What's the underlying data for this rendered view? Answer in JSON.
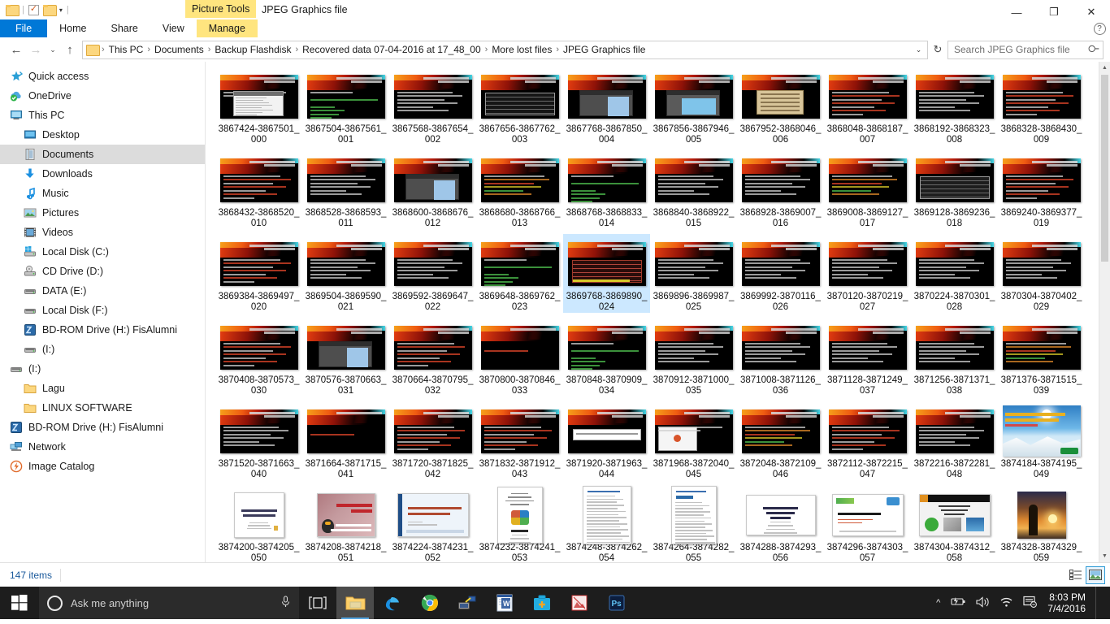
{
  "window": {
    "context_tab_group": "Picture Tools",
    "title": "JPEG Graphics file",
    "minimize": "—",
    "maximize": "❐",
    "close": "✕"
  },
  "ribbon": {
    "tabs": [
      {
        "label": "File",
        "type": "file"
      },
      {
        "label": "Home",
        "type": "normal"
      },
      {
        "label": "Share",
        "type": "normal"
      },
      {
        "label": "View",
        "type": "normal"
      },
      {
        "label": "Manage",
        "type": "contextual"
      }
    ],
    "help": "?"
  },
  "addressbar": {
    "back": "←",
    "forward": "→",
    "recent": "⌄",
    "up": "↑",
    "breadcrumbs": [
      "This PC",
      "Documents",
      "Backup Flashdisk",
      "Recovered data 07-04-2016 at 17_48_00",
      "More lost files",
      "JPEG Graphics file"
    ],
    "separator": "›",
    "dropdown": "⌄",
    "refresh": "↻",
    "search_placeholder": "Search JPEG Graphics file",
    "search_value": ""
  },
  "sidebar": {
    "items": [
      {
        "label": "Quick access",
        "icon": "star-icon",
        "indent": 0,
        "selected": false
      },
      {
        "label": "OneDrive",
        "icon": "cloud-icon",
        "indent": 0,
        "selected": false
      },
      {
        "label": "This PC",
        "icon": "monitor-icon",
        "indent": 0,
        "selected": false
      },
      {
        "label": "Desktop",
        "icon": "desktop-icon",
        "indent": 1,
        "selected": false
      },
      {
        "label": "Documents",
        "icon": "documents-icon",
        "indent": 1,
        "selected": true
      },
      {
        "label": "Downloads",
        "icon": "download-icon",
        "indent": 1,
        "selected": false
      },
      {
        "label": "Music",
        "icon": "music-icon",
        "indent": 1,
        "selected": false
      },
      {
        "label": "Pictures",
        "icon": "pictures-icon",
        "indent": 1,
        "selected": false
      },
      {
        "label": "Videos",
        "icon": "videos-icon",
        "indent": 1,
        "selected": false
      },
      {
        "label": "Local Disk (C:)",
        "icon": "windows-drive-icon",
        "indent": 1,
        "selected": false
      },
      {
        "label": "CD Drive (D:)",
        "icon": "cd-drive-icon",
        "indent": 1,
        "selected": false
      },
      {
        "label": "DATA (E:)",
        "icon": "drive-icon",
        "indent": 1,
        "selected": false
      },
      {
        "label": "Local Disk (F:)",
        "icon": "drive-icon",
        "indent": 1,
        "selected": false
      },
      {
        "label": "BD-ROM Drive (H:) FisAlumni",
        "icon": "bdrom-icon",
        "indent": 1,
        "selected": false
      },
      {
        "label": "(I:)",
        "icon": "drive-icon",
        "indent": 1,
        "selected": false
      },
      {
        "label": "(I:)",
        "icon": "drive-icon",
        "indent": 0,
        "selected": false
      },
      {
        "label": "Lagu",
        "icon": "folder-icon",
        "indent": 1,
        "selected": false
      },
      {
        "label": "LINUX SOFTWARE",
        "icon": "folder-icon",
        "indent": 1,
        "selected": false
      },
      {
        "label": "BD-ROM Drive (H:) FisAlumni",
        "icon": "bdrom-icon",
        "indent": 0,
        "selected": false
      },
      {
        "label": "Network",
        "icon": "network-icon",
        "indent": 0,
        "selected": false
      },
      {
        "label": "Image Catalog",
        "icon": "image-catalog-icon",
        "indent": 0,
        "selected": false
      }
    ]
  },
  "files": [
    {
      "name": "3867424-3867501_000",
      "thumb": "slide-screenshot-light",
      "selected": false
    },
    {
      "name": "3867504-3867561_001",
      "thumb": "slide-code",
      "selected": false
    },
    {
      "name": "3867568-3867654_002",
      "thumb": "slide-text",
      "selected": false
    },
    {
      "name": "3867656-3867762_003",
      "thumb": "slide-table-win",
      "selected": false
    },
    {
      "name": "3867768-3867850_004",
      "thumb": "slide-darkwin",
      "selected": false
    },
    {
      "name": "3867856-3867946_005",
      "thumb": "slide-bluewin",
      "selected": false
    },
    {
      "name": "3867952-3868046_006",
      "thumb": "slide-tanbox",
      "selected": false
    },
    {
      "name": "3868048-3868187_007",
      "thumb": "slide-text-red",
      "selected": false
    },
    {
      "name": "3868192-3868323_008",
      "thumb": "slide-text",
      "selected": false
    },
    {
      "name": "3868328-3868430_009",
      "thumb": "slide-text-red",
      "selected": false
    },
    {
      "name": "3868432-3868520_010",
      "thumb": "slide-text-red",
      "selected": false
    },
    {
      "name": "3868528-3868593_011",
      "thumb": "slide-text",
      "selected": false
    },
    {
      "name": "3868600-3868676_012",
      "thumb": "slide-darkwin",
      "selected": false
    },
    {
      "name": "3868680-3868766_013",
      "thumb": "slide-colorcode",
      "selected": false
    },
    {
      "name": "3868768-3868833_014",
      "thumb": "slide-code",
      "selected": false
    },
    {
      "name": "3868840-3868922_015",
      "thumb": "slide-text",
      "selected": false
    },
    {
      "name": "3868928-3869007_016",
      "thumb": "slide-text",
      "selected": false
    },
    {
      "name": "3869008-3869127_017",
      "thumb": "slide-colorcode",
      "selected": false
    },
    {
      "name": "3869128-3869236_018",
      "thumb": "slide-table",
      "selected": false
    },
    {
      "name": "3869240-3869377_019",
      "thumb": "slide-text-red",
      "selected": false
    },
    {
      "name": "3869384-3869497_020",
      "thumb": "slide-text-red",
      "selected": false
    },
    {
      "name": "3869504-3869590_021",
      "thumb": "slide-text",
      "selected": false
    },
    {
      "name": "3869592-3869647_022",
      "thumb": "slide-text",
      "selected": false
    },
    {
      "name": "3869648-3869762_023",
      "thumb": "slide-code",
      "selected": false
    },
    {
      "name": "3869768-3869890_024",
      "thumb": "slide-table-red",
      "selected": true
    },
    {
      "name": "3869896-3869987_025",
      "thumb": "slide-text",
      "selected": false
    },
    {
      "name": "3869992-3870116_026",
      "thumb": "slide-text",
      "selected": false
    },
    {
      "name": "3870120-3870219_027",
      "thumb": "slide-text",
      "selected": false
    },
    {
      "name": "3870224-3870301_028",
      "thumb": "slide-text",
      "selected": false
    },
    {
      "name": "3870304-3870402_029",
      "thumb": "slide-text",
      "selected": false
    },
    {
      "name": "3870408-3870573_030",
      "thumb": "slide-text-red",
      "selected": false
    },
    {
      "name": "3870576-3870663_031",
      "thumb": "slide-darkwin",
      "selected": false
    },
    {
      "name": "3870664-3870795_032",
      "thumb": "slide-text-red",
      "selected": false
    },
    {
      "name": "3870800-3870846_033",
      "thumb": "slide-minimal",
      "selected": false
    },
    {
      "name": "3870848-3870909_034",
      "thumb": "slide-code",
      "selected": false
    },
    {
      "name": "3870912-3871000_035",
      "thumb": "slide-text",
      "selected": false
    },
    {
      "name": "3871008-3871126_036",
      "thumb": "slide-text",
      "selected": false
    },
    {
      "name": "3871128-3871249_037",
      "thumb": "slide-text",
      "selected": false
    },
    {
      "name": "3871256-3871371_038",
      "thumb": "slide-text",
      "selected": false
    },
    {
      "name": "3871376-3871515_039",
      "thumb": "slide-colorcode",
      "selected": false
    },
    {
      "name": "3871520-3871663_040",
      "thumb": "slide-text",
      "selected": false
    },
    {
      "name": "3871664-3871715_041",
      "thumb": "slide-minimal",
      "selected": false
    },
    {
      "name": "3871720-3871825_042",
      "thumb": "slide-text-red",
      "selected": false
    },
    {
      "name": "3871832-3871912_043",
      "thumb": "slide-text-red",
      "selected": false
    },
    {
      "name": "3871920-3871963_044",
      "thumb": "slide-whitebox",
      "selected": false
    },
    {
      "name": "3871968-3872040_045",
      "thumb": "slide-whitewin",
      "selected": false
    },
    {
      "name": "3872048-3872109_046",
      "thumb": "slide-colorcode",
      "selected": false
    },
    {
      "name": "3872112-3872215_047",
      "thumb": "slide-text-red",
      "selected": false
    },
    {
      "name": "3872216-3872281_048",
      "thumb": "slide-text",
      "selected": false
    },
    {
      "name": "3874184-3874195_049",
      "thumb": "photo-mountain",
      "selected": false
    },
    {
      "name": "3874200-3874205_050",
      "thumb": "doc-title",
      "selected": false
    },
    {
      "name": "3874208-3874218_051",
      "thumb": "doc-linux",
      "selected": false
    },
    {
      "name": "3874224-3874231_052",
      "thumb": "doc-blueslide",
      "selected": false
    },
    {
      "name": "3874232-3874241_053",
      "thumb": "doc-cover",
      "selected": false
    },
    {
      "name": "3874248-3874262_054",
      "thumb": "doc-text",
      "selected": false
    },
    {
      "name": "3874264-3874282_055",
      "thumb": "doc-text2",
      "selected": false
    },
    {
      "name": "3874288-3874293_056",
      "thumb": "doc-title2",
      "selected": false
    },
    {
      "name": "3874296-3874303_057",
      "thumb": "doc-proposal",
      "selected": false
    },
    {
      "name": "3874304-3874312_058",
      "thumb": "doc-opensource",
      "selected": false
    },
    {
      "name": "3874328-3874329_059",
      "thumb": "photo-sunset",
      "selected": false
    }
  ],
  "statusbar": {
    "item_count": "147 items",
    "view_details": "details-view",
    "view_thumbnails": "large-icons-view"
  },
  "taskbar": {
    "start": "start-button",
    "search_placeholder": "Ask me anything",
    "mic": "microphone-icon",
    "apps": [
      {
        "name": "task-view-button",
        "active": false
      },
      {
        "name": "file-explorer-button",
        "active": true
      },
      {
        "name": "edge-button",
        "active": false
      },
      {
        "name": "chrome-button",
        "active": false
      },
      {
        "name": "network-tool-button",
        "active": false
      },
      {
        "name": "word-button",
        "active": false
      },
      {
        "name": "toolkit-button",
        "active": false
      },
      {
        "name": "image-viewer-button",
        "active": false
      },
      {
        "name": "photoshop-button",
        "active": false
      }
    ],
    "tray": {
      "chevron": "^",
      "battery": "battery-icon",
      "volume": "volume-icon",
      "wifi": "wifi-icon",
      "action_center": "action-center-icon"
    },
    "time": "8:03 PM",
    "date": "7/4/2016"
  },
  "colors": {
    "accent": "#0078d7",
    "contextual_tab": "#ffe57f",
    "selection": "#cce8ff",
    "sidebar_selected": "#dcdcdc"
  }
}
